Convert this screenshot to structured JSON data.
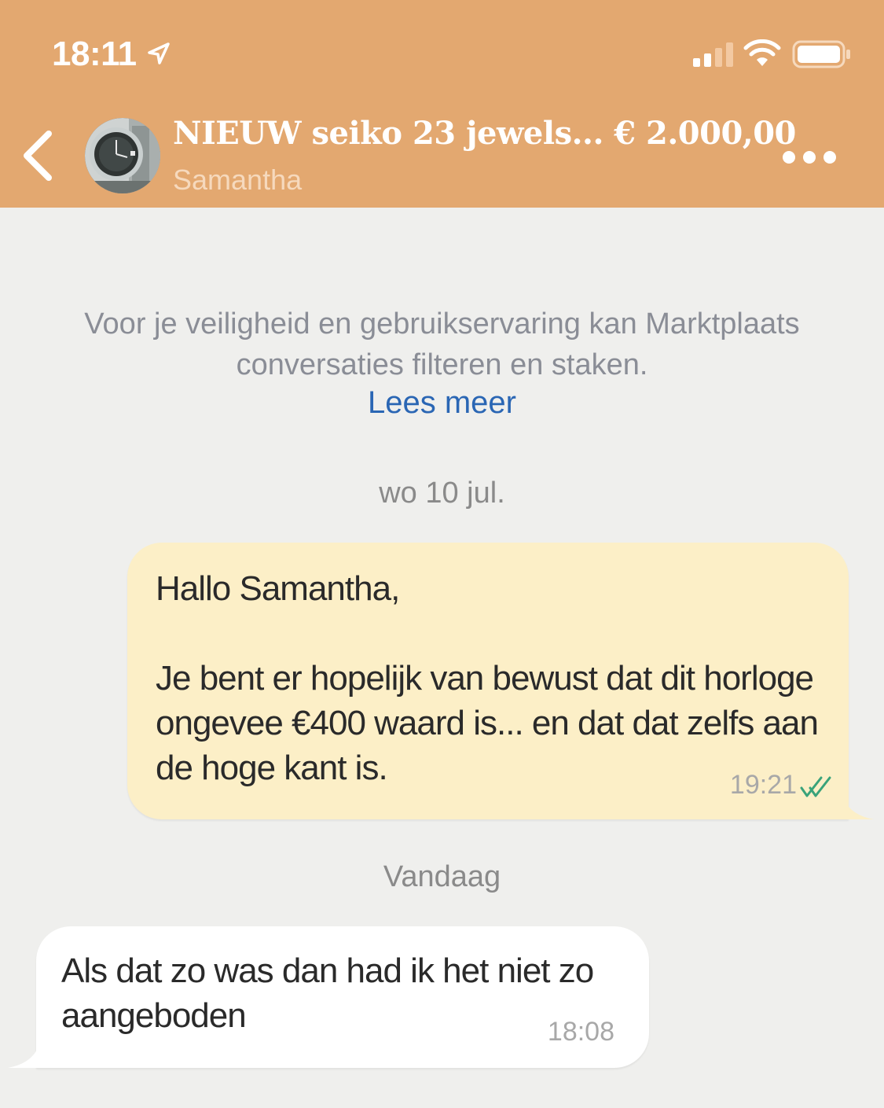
{
  "status_bar": {
    "time": "18:11"
  },
  "header": {
    "title": "NIEUW seiko 23 jewels... € 2.000,00",
    "subtitle": "Samantha"
  },
  "notice": {
    "text": "Voor je veiligheid en gebruikservaring kan Marktplaats conversaties filteren en staken.",
    "link": "Lees meer"
  },
  "messages": [
    {
      "date_label": "wo 10 jul.",
      "direction": "outgoing",
      "text": "Hallo Samantha,\n\nJe bent er hopelijk van bewust dat dit horloge ongevee €400 waard is... en dat dat zelfs aan de hoge kant is.",
      "time": "19:21",
      "status": "read"
    },
    {
      "date_label": "Vandaag",
      "direction": "incoming",
      "text": "Als dat zo was dan had ik het niet zo aangeboden",
      "time": "18:08"
    }
  ],
  "colors": {
    "header_bg": "#e3a870",
    "page_bg": "#efefed",
    "outgoing_bubble": "#fcefc7",
    "incoming_bubble": "#ffffff",
    "link": "#2a66b4",
    "read_check": "#3aa37a"
  },
  "icons": {
    "back": "chevron-left-icon",
    "more": "more-dots-icon",
    "location": "location-arrow-icon",
    "signal": "signal-icon",
    "wifi": "wifi-icon",
    "battery": "battery-icon",
    "read_receipt": "double-check-icon"
  }
}
